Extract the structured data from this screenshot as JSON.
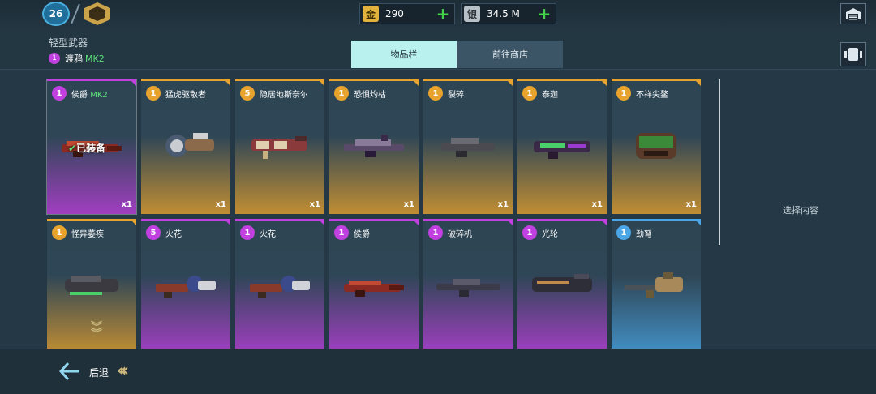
{
  "player": {
    "level": "26"
  },
  "currency": {
    "gold": {
      "icon": "金",
      "value": "290"
    },
    "silver": {
      "icon": "银",
      "value": "34.5 M"
    }
  },
  "header": {
    "category_title": "轻型武器",
    "current_weapon": {
      "rank": "1",
      "name": "渡鸦",
      "mark": "MK2"
    }
  },
  "tabs": [
    {
      "label": "物品栏"
    },
    {
      "label": "前往商店"
    }
  ],
  "right_panel": {
    "hint": "选择内容"
  },
  "footer": {
    "back_label": "后退"
  },
  "rarity_colors": {
    "epic": "#c040e0",
    "legendary": "#e8a32e",
    "rare": "#4aa6e6"
  },
  "items": [
    {
      "rank": "1",
      "name": "侯爵",
      "mark": "MK2",
      "qty": "x1",
      "rarity": "epic",
      "equipped_label": "已装备",
      "gun_icon": "red-cannon-icon"
    },
    {
      "rank": "1",
      "name": "猛虎驱散者",
      "mark": "",
      "qty": "x1",
      "rarity": "legendary",
      "gun_icon": "drum-gun-icon"
    },
    {
      "rank": "5",
      "name": "隐居地斯奈尔",
      "mark": "",
      "qty": "x1",
      "rarity": "legendary",
      "gun_icon": "ornate-rifle-icon"
    },
    {
      "rank": "1",
      "name": "恐惧灼枯",
      "mark": "",
      "qty": "x1",
      "rarity": "legendary",
      "gun_icon": "purple-rifle-icon"
    },
    {
      "rank": "1",
      "name": "裂碎",
      "mark": "",
      "qty": "x1",
      "rarity": "legendary",
      "gun_icon": "dark-blaster-icon"
    },
    {
      "rank": "1",
      "name": "泰迦",
      "mark": "",
      "qty": "x1",
      "rarity": "legendary",
      "gun_icon": "green-blaster-icon"
    },
    {
      "rank": "1",
      "name": "不祥尖鳌",
      "mark": "",
      "qty": "x1",
      "rarity": "legendary",
      "gun_icon": "pod-launcher-icon"
    },
    {
      "rank": "1",
      "name": "怪异萎疾",
      "mark": "",
      "qty": "",
      "rarity": "legendary",
      "gun_icon": "toxic-launcher-icon"
    },
    {
      "rank": "5",
      "name": "火花",
      "mark": "",
      "qty": "",
      "rarity": "epic",
      "gun_icon": "tesla-gun-icon"
    },
    {
      "rank": "1",
      "name": "火花",
      "mark": "",
      "qty": "",
      "rarity": "epic",
      "gun_icon": "tesla-gun-icon"
    },
    {
      "rank": "1",
      "name": "侯爵",
      "mark": "",
      "qty": "",
      "rarity": "epic",
      "gun_icon": "red-cannon-icon"
    },
    {
      "rank": "1",
      "name": "破碎机",
      "mark": "",
      "qty": "",
      "rarity": "epic",
      "gun_icon": "long-rifle-icon"
    },
    {
      "rank": "1",
      "name": "光轮",
      "mark": "",
      "qty": "",
      "rarity": "epic",
      "gun_icon": "heavy-cannon-icon"
    },
    {
      "rank": "1",
      "name": "劲弩",
      "mark": "",
      "qty": "",
      "rarity": "rare",
      "gun_icon": "crossbow-gun-icon"
    }
  ]
}
